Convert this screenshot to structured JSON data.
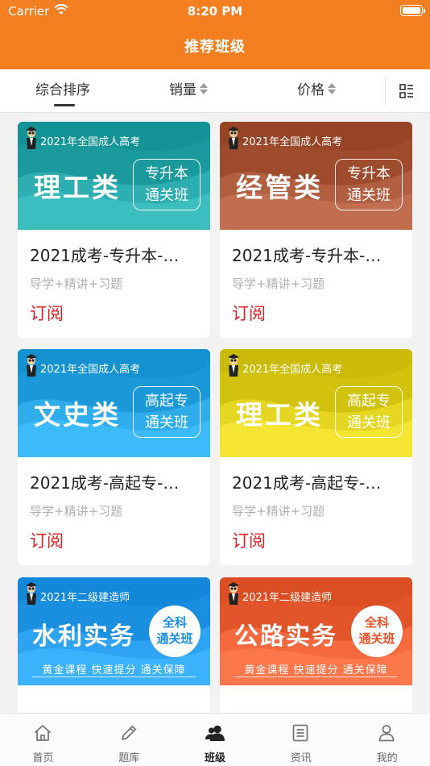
{
  "status_bar": {
    "carrier": "Carrier",
    "time": "8:20 PM"
  },
  "header": {
    "title": "推荐班级"
  },
  "sort_bar": {
    "items": [
      {
        "label": "综合排序",
        "active": true
      },
      {
        "label": "销量",
        "active": false
      },
      {
        "label": "价格",
        "active": false
      }
    ],
    "layout_icon": "list-layout-icon"
  },
  "courses": [
    {
      "tagline": "2021年全国成人高考",
      "banner_title": "理工类",
      "label_lines": [
        "专升本",
        "通关班"
      ],
      "title": "2021成考-专升本-…",
      "subtitle": "导学+精讲+习题",
      "action": "订阅",
      "color": "#1a9a9c"
    },
    {
      "tagline": "2021年全国成人高考",
      "banner_title": "经管类",
      "label_lines": [
        "专升本",
        "通关班"
      ],
      "title": "2021成考-专升本-…",
      "subtitle": "导学+精讲+习题",
      "action": "订阅",
      "color": "#9e4a2c"
    },
    {
      "tagline": "2021年全国成人高考",
      "banner_title": "文史类",
      "label_lines": [
        "高起专",
        "通关班"
      ],
      "title": "2021成考-高起专-…",
      "subtitle": "导学+精讲+习题",
      "action": "订阅",
      "color": "#1a98d8"
    },
    {
      "tagline": "2021年全国成人高考",
      "banner_title": "理工类",
      "label_lines": [
        "高起专",
        "通关班"
      ],
      "title": "2021成考-高起专-…",
      "subtitle": "导学+精讲+习题",
      "action": "订阅",
      "color": "#d1c20e"
    },
    {
      "tagline": "2021年二级建造师",
      "banner_title": "水利实务",
      "label_lines": [
        "全科",
        "通关班"
      ],
      "slogan": "黄金课程 快速提分 通关保障",
      "color": "#1a8fe0"
    },
    {
      "tagline": "2021年二级建造师",
      "banner_title": "公路实务",
      "label_lines": [
        "全科",
        "通关班"
      ],
      "slogan": "黄金课程 快速提分 通关保障",
      "color": "#e2542a"
    }
  ],
  "tab_bar": {
    "items": [
      {
        "label": "首页",
        "icon": "home-icon",
        "active": false
      },
      {
        "label": "题库",
        "icon": "pencil-icon",
        "active": false
      },
      {
        "label": "班级",
        "icon": "class-icon",
        "active": true
      },
      {
        "label": "资讯",
        "icon": "news-icon",
        "active": false
      },
      {
        "label": "我的",
        "icon": "profile-icon",
        "active": false
      }
    ]
  }
}
